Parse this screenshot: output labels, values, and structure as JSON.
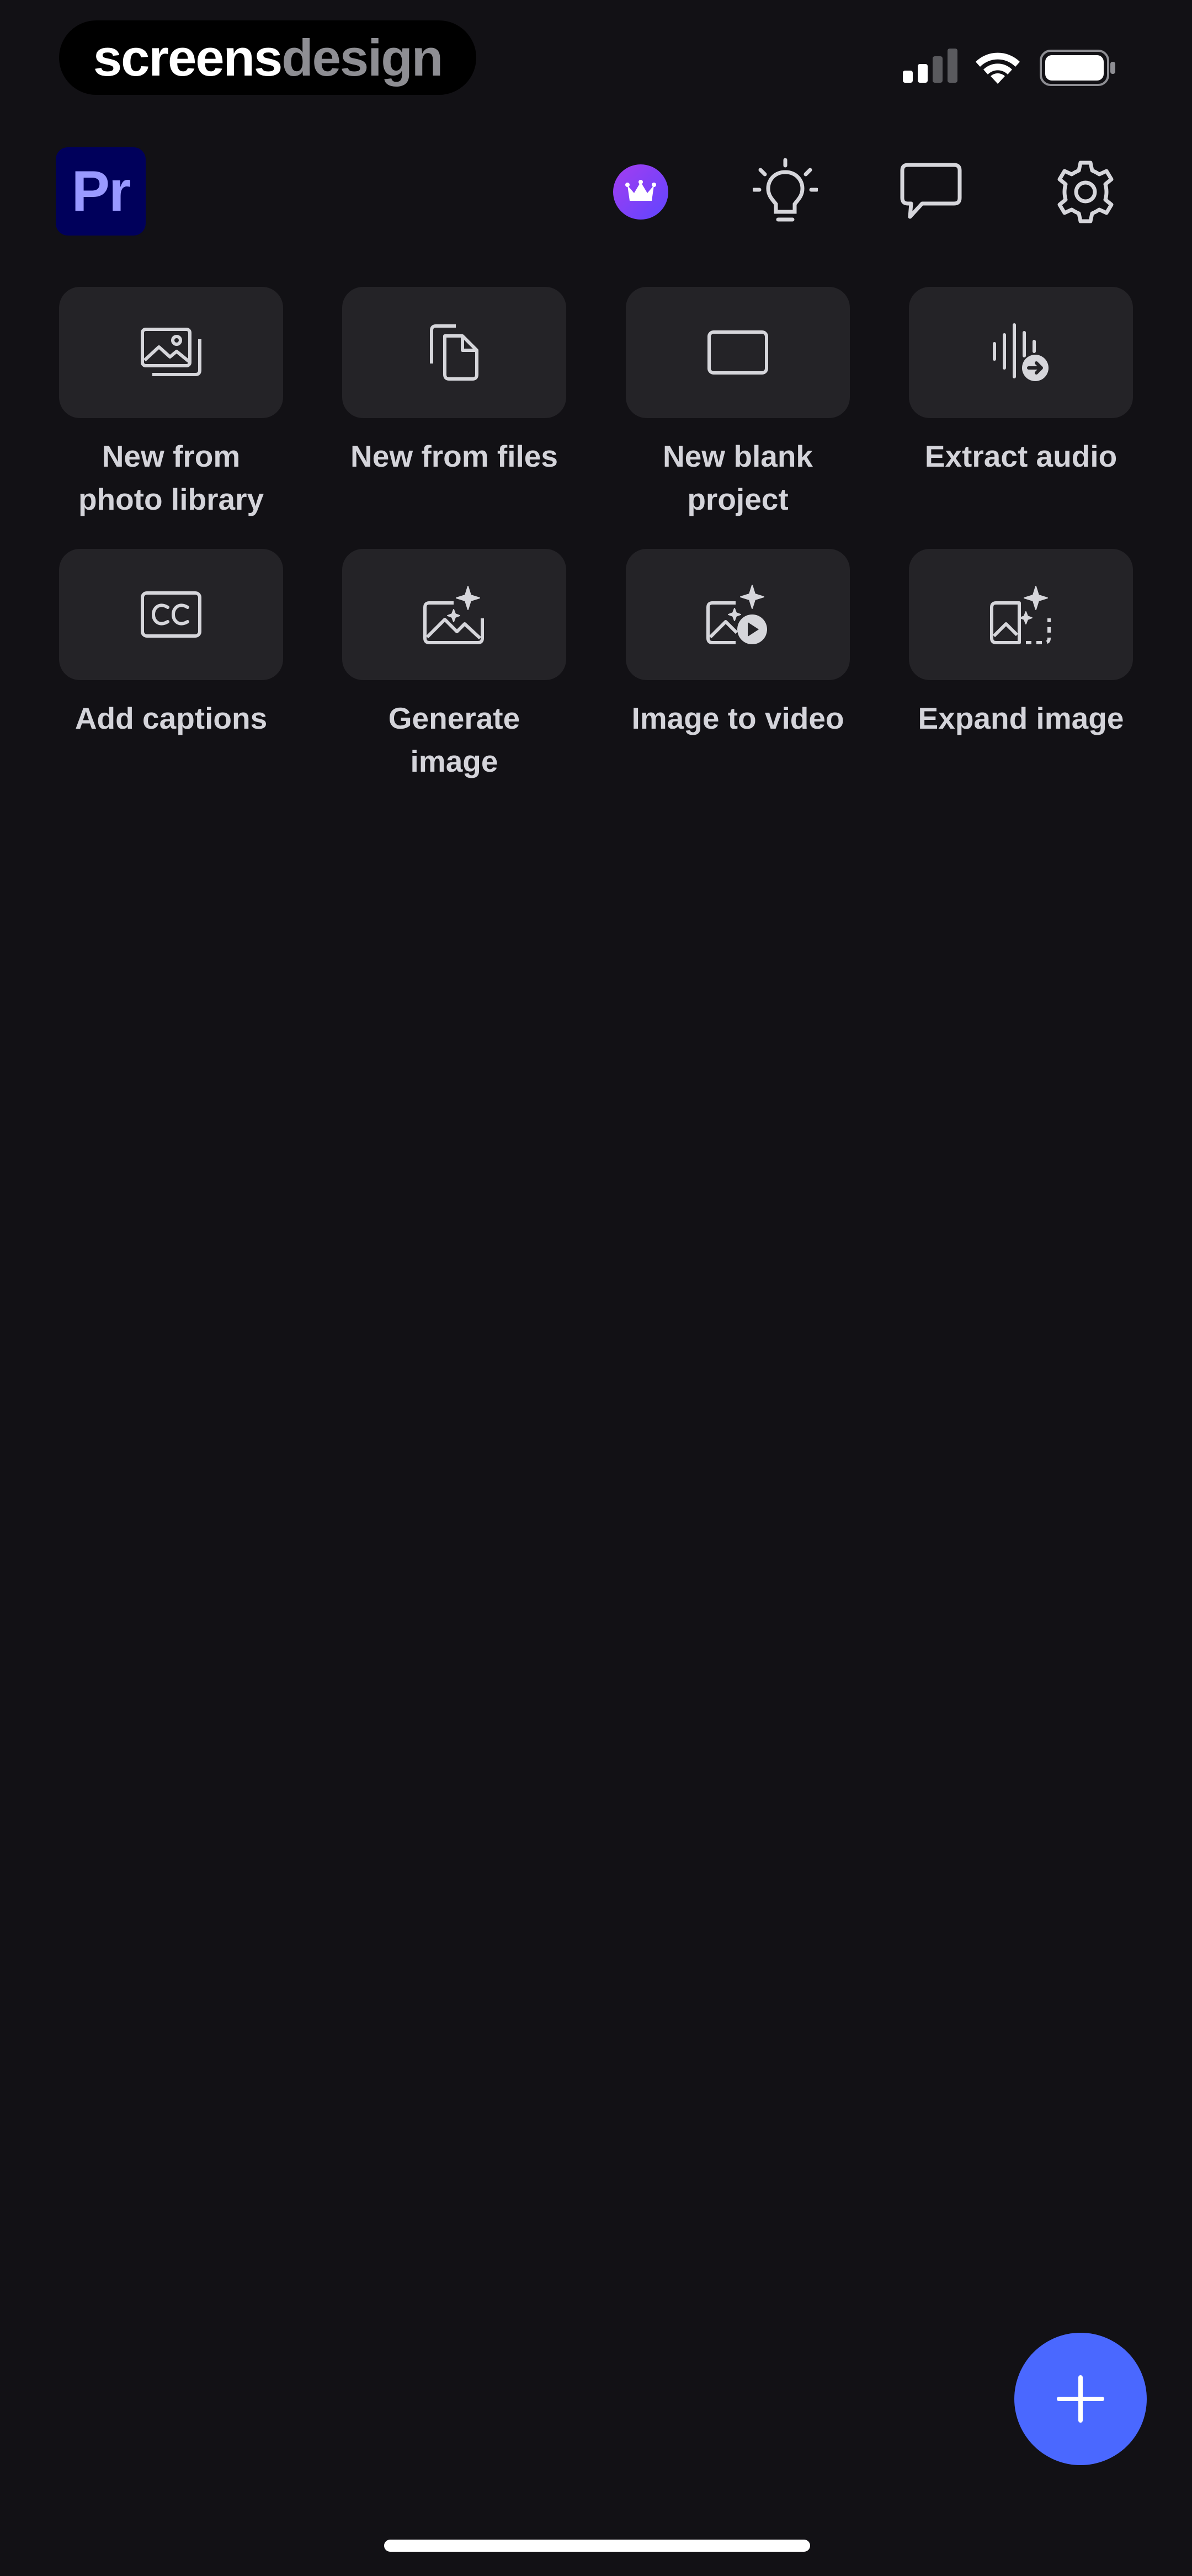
{
  "watermark": {
    "part1": "screens",
    "part2": "design"
  },
  "status_bar": {
    "signal_icon": "cellular-signal-icon",
    "wifi_icon": "wifi-icon",
    "battery_icon": "battery-icon"
  },
  "header": {
    "app_logo": "Pr",
    "icons": [
      "crown-icon",
      "lightbulb-icon",
      "speech-bubble-icon",
      "gear-icon"
    ]
  },
  "actions": [
    {
      "label": "New from\nphoto library",
      "icon": "photo-library-icon"
    },
    {
      "label": "New from files",
      "icon": "files-icon"
    },
    {
      "label": "New blank\nproject",
      "icon": "blank-rectangle-icon"
    },
    {
      "label": "Extract audio",
      "icon": "audio-extract-icon"
    },
    {
      "label": "Add captions",
      "icon": "cc-icon"
    },
    {
      "label": "Generate image",
      "icon": "sparkle-image-icon"
    },
    {
      "label": "Image to video",
      "icon": "image-video-icon"
    },
    {
      "label": "Expand image",
      "icon": "expand-image-icon"
    }
  ],
  "fab": {
    "icon": "plus-icon"
  },
  "colors": {
    "background": "#121115",
    "tile": "#242327",
    "accent": "#4a68ff",
    "logo_bg": "#00005b",
    "logo_text": "#9999ff"
  }
}
